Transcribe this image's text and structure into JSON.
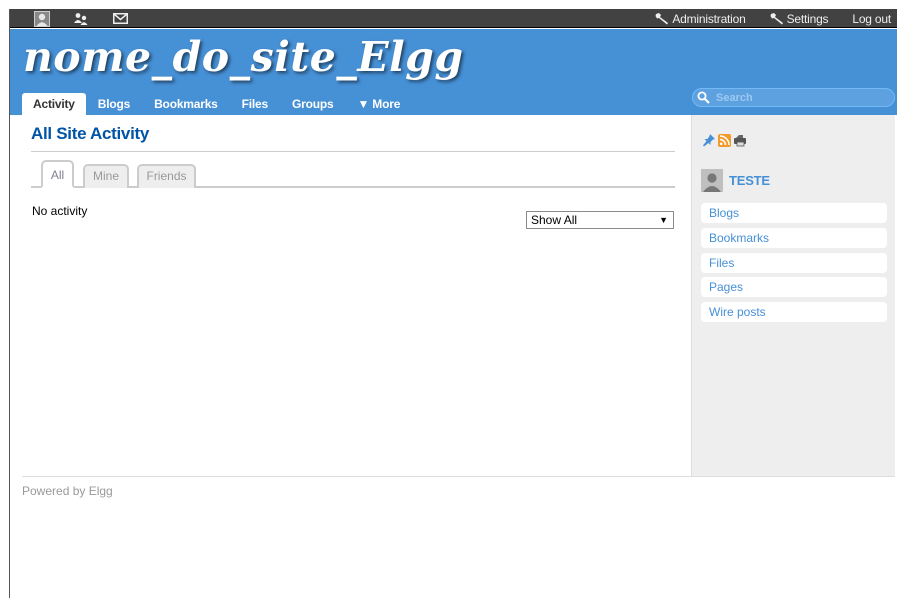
{
  "topbar": {
    "icons": [
      "avatar-icon",
      "friends-icon",
      "mail-icon"
    ],
    "admin_label": "Administration",
    "settings_label": "Settings",
    "logout_label": "Log out"
  },
  "header": {
    "site_name": "nome_do_site_Elgg",
    "menu": [
      {
        "label": "Activity",
        "selected": true
      },
      {
        "label": "Blogs"
      },
      {
        "label": "Bookmarks"
      },
      {
        "label": "Files"
      },
      {
        "label": "Groups"
      },
      {
        "label": "▼ More"
      }
    ],
    "search_placeholder": "Search"
  },
  "main": {
    "title": "All Site Activity",
    "tabs": [
      {
        "label": "All",
        "selected": true
      },
      {
        "label": "Mine"
      },
      {
        "label": "Friends"
      }
    ],
    "empty_message": "No activity",
    "filter_value": "Show All"
  },
  "sidebar": {
    "icons": [
      "pin-icon",
      "rss-icon",
      "print-icon"
    ],
    "owner_name": "TESTE",
    "items": [
      "Blogs",
      "Bookmarks",
      "Files",
      "Pages",
      "Wire posts"
    ]
  },
  "footer": {
    "text": "Powered by Elgg"
  },
  "colors": {
    "header": "#4690d6",
    "topbar": "#424242",
    "link": "#4690d6",
    "title": "#0054a7",
    "sidebar_bg": "#eeeeee"
  }
}
